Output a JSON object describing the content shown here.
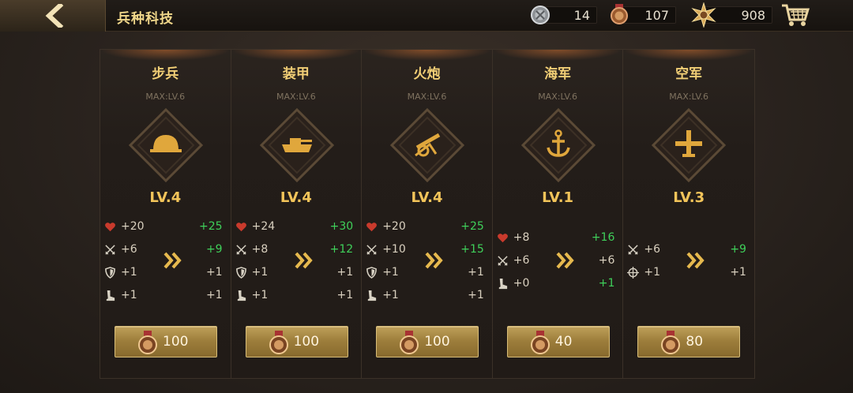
{
  "header": {
    "title": "兵种科技",
    "resources": [
      {
        "name": "silver-medal",
        "value": "14",
        "color": "#aeb2b6"
      },
      {
        "name": "bronze-medal",
        "value": "107",
        "color": "#c07a44"
      },
      {
        "name": "gold-star",
        "value": "908",
        "color": "#e0b060"
      }
    ]
  },
  "cards": [
    {
      "name": "步兵",
      "max": "MAX:LV.6",
      "level": "LV.4",
      "icon": "helmet-icon",
      "stats": [
        {
          "icon": "heart-icon",
          "cur": "+20",
          "next": "+25",
          "up": true
        },
        {
          "icon": "crossed-swords-icon",
          "cur": "+6",
          "next": "+9",
          "up": true
        },
        {
          "icon": "shield-icon",
          "cur": "+1",
          "next": "+1",
          "up": false
        },
        {
          "icon": "boot-icon",
          "cur": "+1",
          "next": "+1",
          "up": false
        }
      ],
      "cost": "100"
    },
    {
      "name": "装甲",
      "max": "MAX:LV.6",
      "level": "LV.4",
      "icon": "tank-icon",
      "stats": [
        {
          "icon": "heart-icon",
          "cur": "+24",
          "next": "+30",
          "up": true
        },
        {
          "icon": "crossed-swords-icon",
          "cur": "+8",
          "next": "+12",
          "up": true
        },
        {
          "icon": "shield-icon",
          "cur": "+1",
          "next": "+1",
          "up": false
        },
        {
          "icon": "boot-icon",
          "cur": "+1",
          "next": "+1",
          "up": false
        }
      ],
      "cost": "100"
    },
    {
      "name": "火炮",
      "max": "MAX:LV.6",
      "level": "LV.4",
      "icon": "cannon-icon",
      "stats": [
        {
          "icon": "heart-icon",
          "cur": "+20",
          "next": "+25",
          "up": true
        },
        {
          "icon": "crossed-swords-icon",
          "cur": "+10",
          "next": "+15",
          "up": true
        },
        {
          "icon": "shield-icon",
          "cur": "+1",
          "next": "+1",
          "up": false
        },
        {
          "icon": "boot-icon",
          "cur": "+1",
          "next": "+1",
          "up": false
        }
      ],
      "cost": "100"
    },
    {
      "name": "海军",
      "max": "MAX:LV.6",
      "level": "LV.1",
      "icon": "anchor-icon",
      "stats": [
        {
          "icon": "heart-icon",
          "cur": "+8",
          "next": "+16",
          "up": true
        },
        {
          "icon": "crossed-swords-icon",
          "cur": "+6",
          "next": "+6",
          "up": false
        },
        {
          "icon": "boot-icon",
          "cur": "+0",
          "next": "+1",
          "up": true
        }
      ],
      "cost": "40"
    },
    {
      "name": "空军",
      "max": "MAX:LV.6",
      "level": "LV.3",
      "icon": "plane-icon",
      "stats": [
        {
          "icon": "crossed-swords-icon",
          "cur": "+6",
          "next": "+9",
          "up": true
        },
        {
          "icon": "crosshair-icon",
          "cur": "+1",
          "next": "+1",
          "up": false
        }
      ],
      "cost": "80"
    }
  ]
}
